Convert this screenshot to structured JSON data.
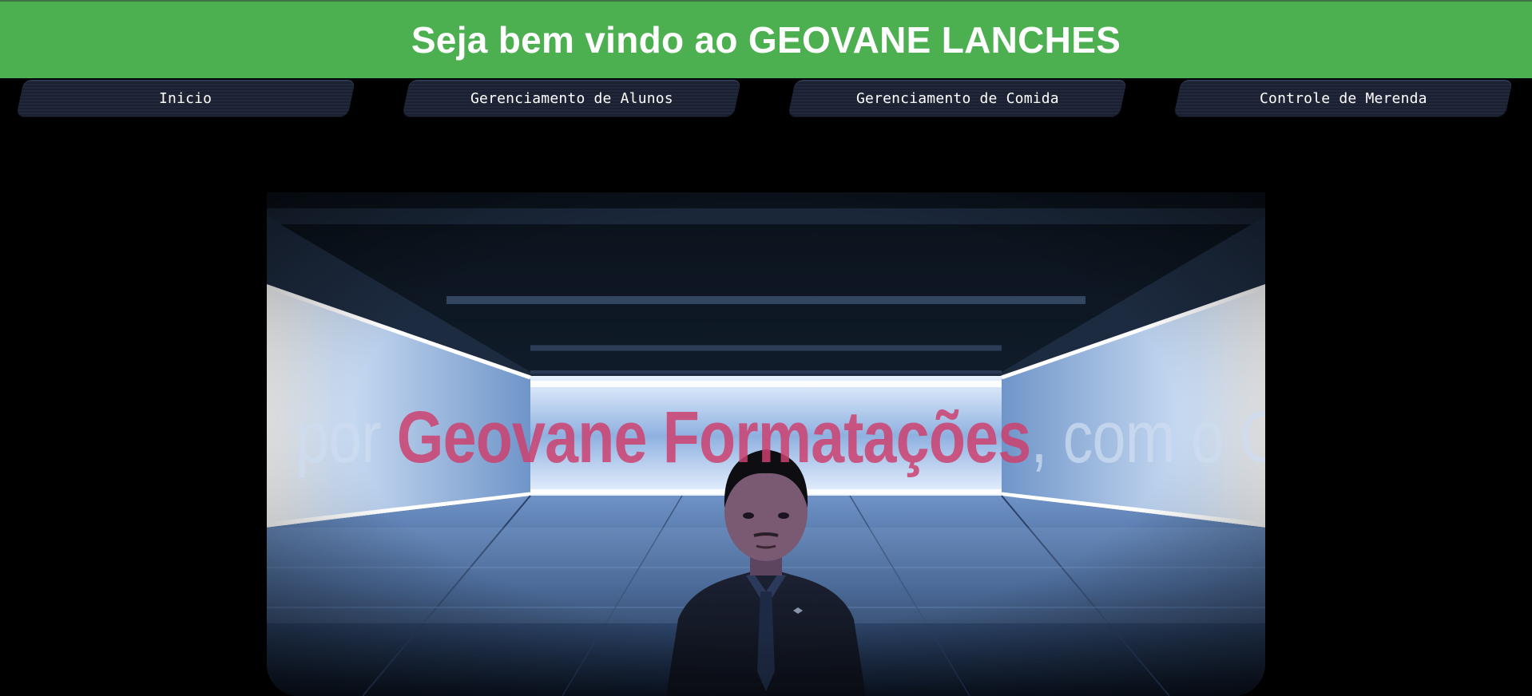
{
  "header": {
    "title": "Seja bem vindo ao GEOVANE LANCHES",
    "background_color": "#4caf50"
  },
  "nav": {
    "items": [
      {
        "label": "Inicio"
      },
      {
        "label": "Gerenciamento de Alunos"
      },
      {
        "label": "Gerenciamento de Comida"
      },
      {
        "label": "Controle de Merenda"
      }
    ],
    "button_color": "#22283b"
  },
  "hero": {
    "banner_prefix": "por ",
    "banner_brand": "Geovane Formatações",
    "banner_suffix": ", com o O"
  },
  "colors": {
    "page_background": "#000000",
    "brand_text": "#cd416e",
    "room_light": "#7ea6dc"
  }
}
